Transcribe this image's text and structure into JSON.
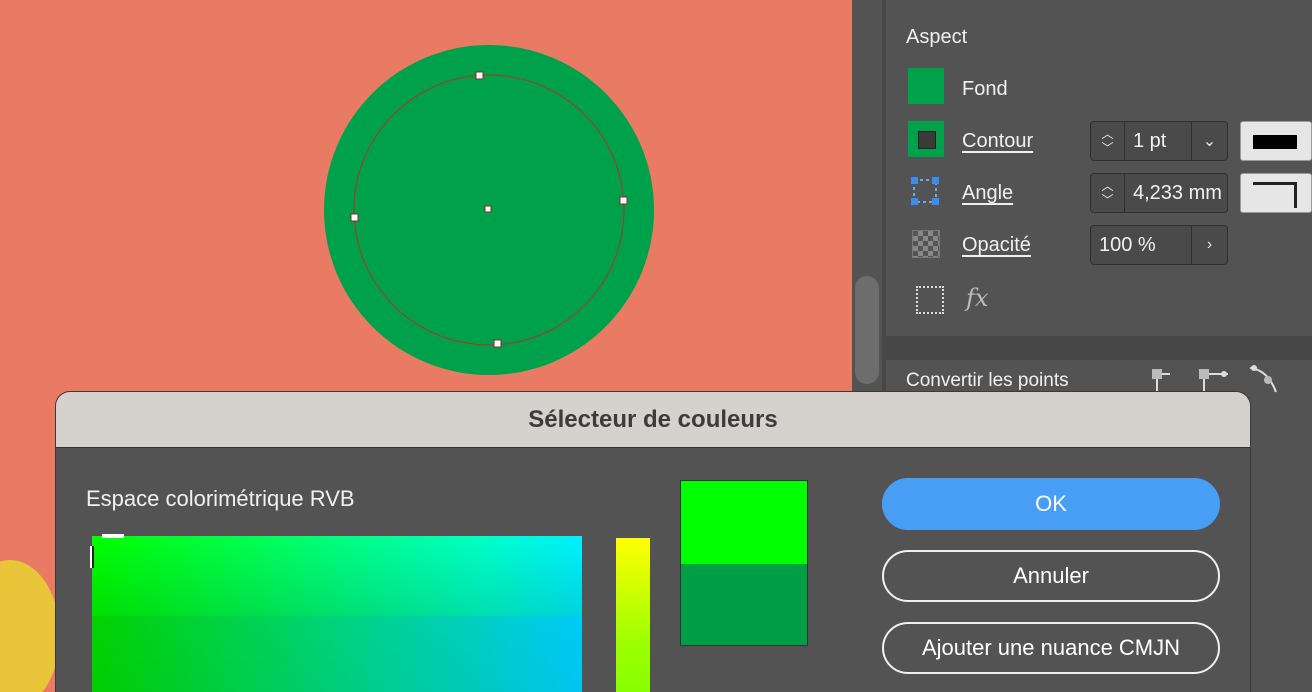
{
  "panel": {
    "aspect_title": "Aspect",
    "fill_label": "Fond",
    "stroke_label": "Contour",
    "stroke_weight": "1 pt",
    "corner_label": "Angle",
    "corner_value": "4,233 mm",
    "opacity_label": "Opacité",
    "opacity_value": "100 %",
    "fx_label": "fx",
    "convert_points_title": "Convertir les points"
  },
  "dialog": {
    "title": "Sélecteur de couleurs",
    "space_label": "Espace colorimétrique RVB",
    "ok_label": "OK",
    "cancel_label": "Annuler",
    "add_swatch_label": "Ajouter une nuance CMJN"
  },
  "colors": {
    "canvas_bg": "#e97b64",
    "circle_fill": "#00a14b",
    "new_color": "#00ff00",
    "old_color": "#009f45",
    "accent": "#489ef4"
  }
}
